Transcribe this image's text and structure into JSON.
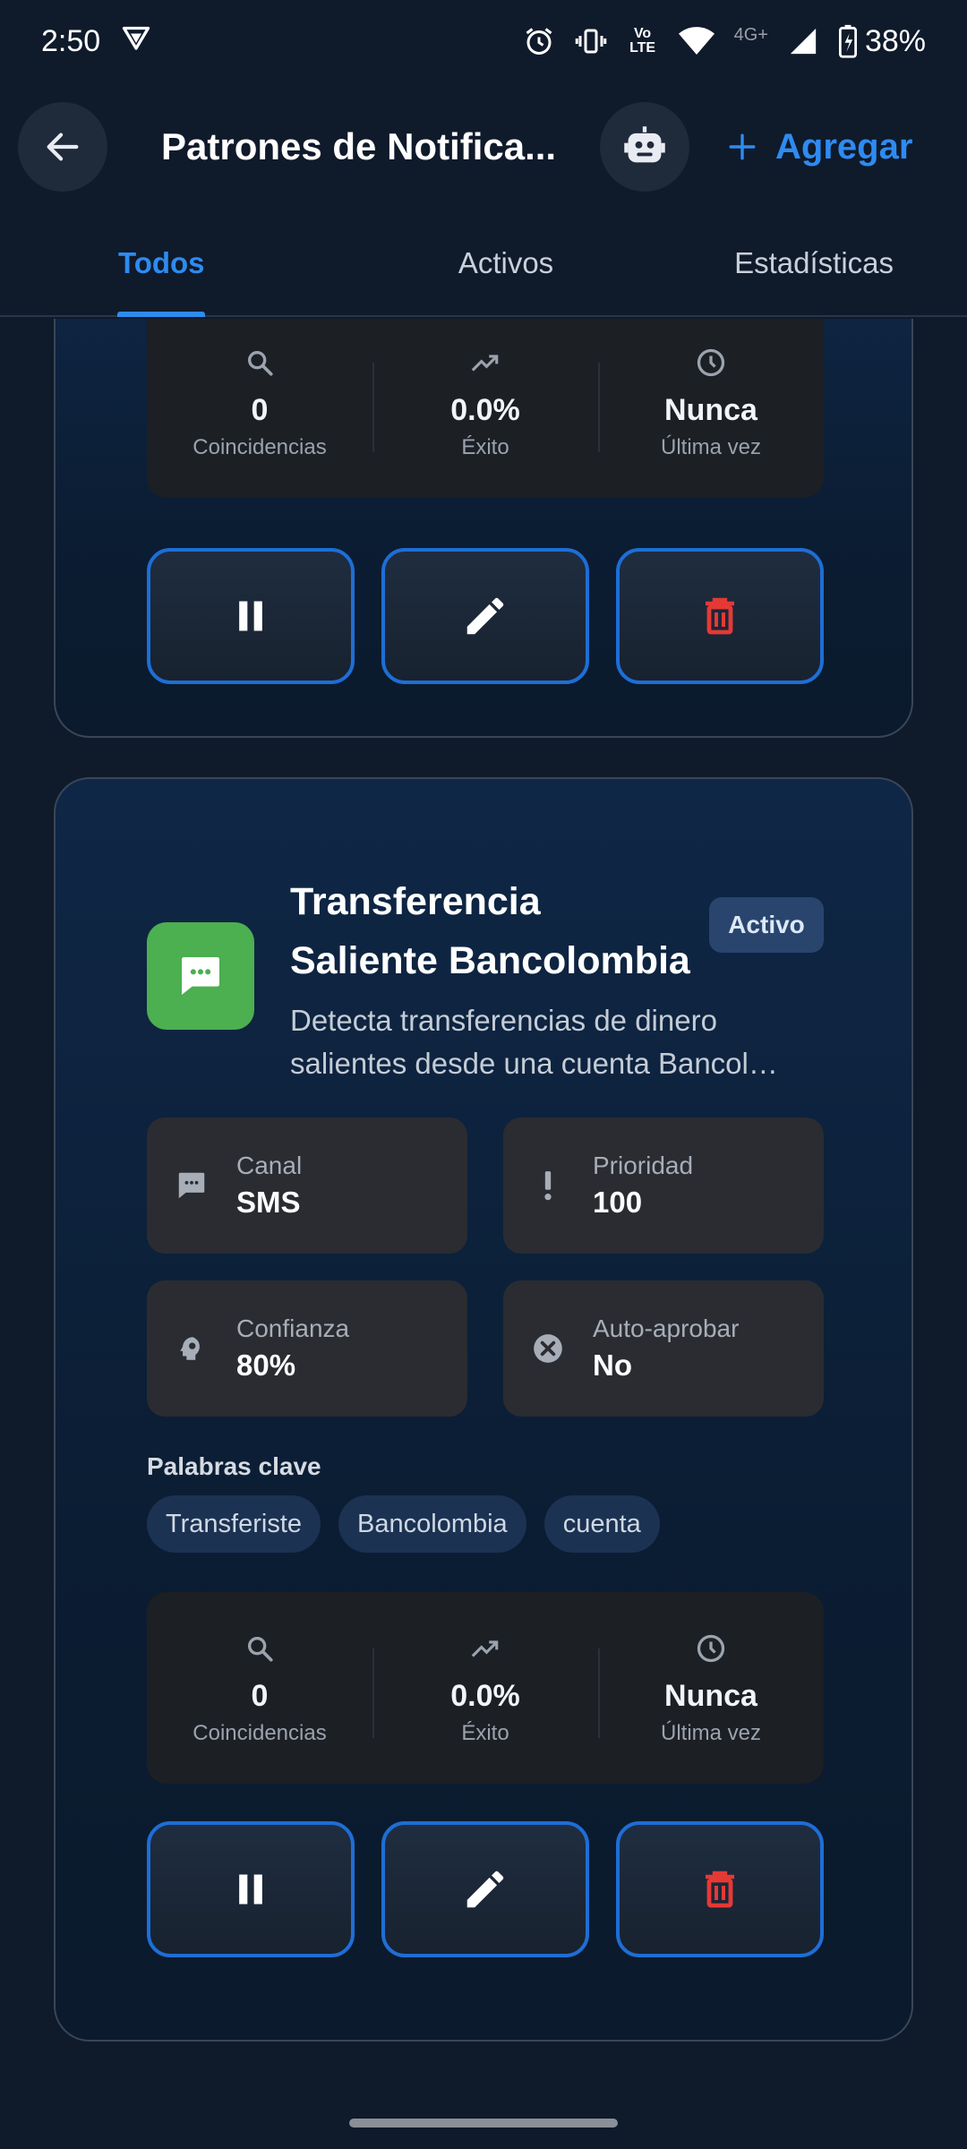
{
  "status_bar": {
    "time": "2:50",
    "battery": "38%",
    "network": "4G+",
    "volte": "Vo LTE"
  },
  "app_bar": {
    "title": "Patrones de Notifica...",
    "add_label": "Agregar"
  },
  "tabs": [
    "Todos",
    "Activos",
    "Estadísticas"
  ],
  "labels": {
    "coincidences": "Coincidencias",
    "success": "Éxito",
    "last_time": "Última vez",
    "channel": "Canal",
    "priority": "Prioridad",
    "confidence": "Confianza",
    "auto_approve": "Auto-aprobar",
    "keywords": "Palabras clave"
  },
  "cards": [
    {
      "stats": {
        "coincidences": "0",
        "success": "0.0%",
        "last_time": "Nunca"
      }
    },
    {
      "title_line1": "Transferencia",
      "title_line2": "Saliente Bancolombia",
      "badge": "Activo",
      "desc_line1": "Detecta transferencias de dinero",
      "desc_line2": "salientes desde una cuenta Bancol…",
      "channel": "SMS",
      "priority": "100",
      "confidence": "80%",
      "auto_approve": "No",
      "keywords": [
        "Transferiste",
        "Bancolombia",
        "cuenta"
      ],
      "stats": {
        "coincidences": "0",
        "success": "0.0%",
        "last_time": "Nunca"
      }
    }
  ],
  "colors": {
    "accent": "#2e8bf0",
    "delete": "#e53935",
    "app_icon": "#4caf50"
  }
}
